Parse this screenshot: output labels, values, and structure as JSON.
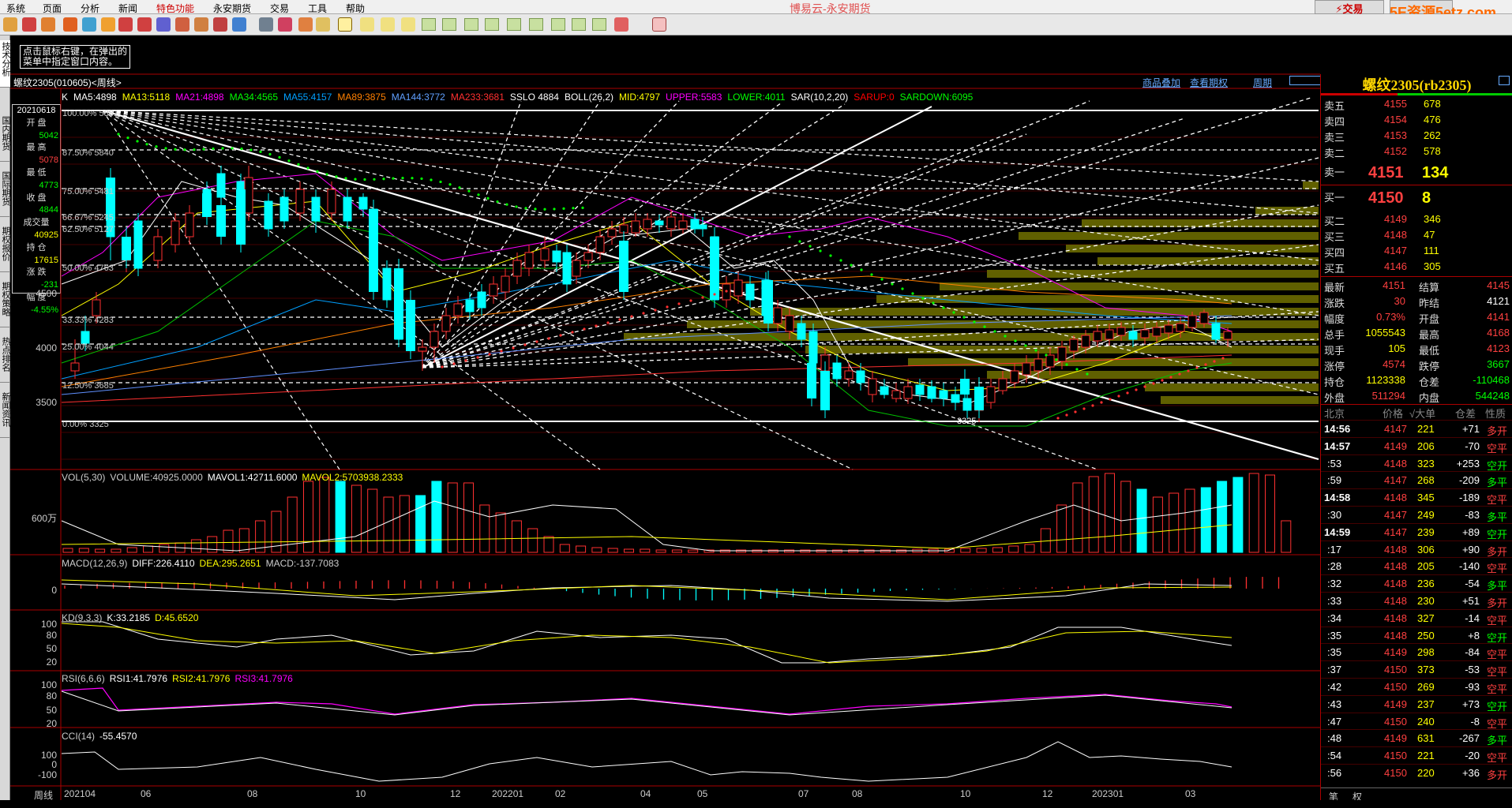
{
  "menu": {
    "items": [
      "系统",
      "页面",
      "分析",
      "新闻",
      "特色功能",
      "永安期货",
      "交易",
      "工具",
      "帮助"
    ],
    "title": "博易云-永安期货",
    "trade": "⚡交易",
    "watermark": "5E资源5etz.com"
  },
  "left_tabs": [
    "技术分析",
    "国内期货",
    "国际期货",
    "期权报价",
    "期权策略",
    "热点排名",
    "新闻资讯"
  ],
  "hint": "点击鼠标右键，在弹出的菜单中指定窗口内容。",
  "chart": {
    "symbol_label": "螺纹2305(010605)<周线>",
    "links": [
      "商品叠加",
      "查看期权",
      "周期"
    ],
    "ma_line": [
      {
        "t": "K",
        "c": "#ffffff"
      },
      {
        "t": "MA5:4898",
        "c": "#ffffff"
      },
      {
        "t": "MA13:5118",
        "c": "#ffff00"
      },
      {
        "t": "MA21:4898",
        "c": "#ff00ff"
      },
      {
        "t": "MA34:4565",
        "c": "#00ff00"
      },
      {
        "t": "MA55:4157",
        "c": "#00a0ff"
      },
      {
        "t": "MA89:3875",
        "c": "#ff8000"
      },
      {
        "t": "MA144:3772",
        "c": "#60a0ff"
      },
      {
        "t": "MA233:3681",
        "c": "#ff3030"
      },
      {
        "t": "SSLO 4884",
        "c": "#ffffff"
      },
      {
        "t": "BOLL(26,2)",
        "c": "#ffffff"
      },
      {
        "t": "MID:4797",
        "c": "#ffff00"
      },
      {
        "t": "UPPER:5583",
        "c": "#ff00ff"
      },
      {
        "t": "LOWER:4011",
        "c": "#00ff00"
      },
      {
        "t": "SAR(10,2,20)",
        "c": "#ffffff"
      },
      {
        "t": "SARUP:0",
        "c": "#ff0000"
      },
      {
        "t": "SARDOWN:6095",
        "c": "#00ff00"
      }
    ],
    "fib": [
      {
        "p": "100.00%",
        "v": "5881"
      },
      {
        "p": "87.50%",
        "v": "5840"
      },
      {
        "p": "75.00%",
        "v": "5481"
      },
      {
        "p": "66.67%",
        "v": "5245"
      },
      {
        "p": "62.50%",
        "v": "5127"
      },
      {
        "p": "50.00%",
        "v": "4763"
      },
      {
        "p": "33.33%",
        "v": "4283"
      },
      {
        "p": "25.00%",
        "v": "4044"
      },
      {
        "p": "12.50%",
        "v": "3685"
      },
      {
        "p": "0.00%",
        "v": "3325"
      }
    ],
    "price_axis": [
      "4500",
      "4000",
      "3500"
    ],
    "low_mark": "3325",
    "vol_label": [
      {
        "t": "VOL(5,30)",
        "c": "#ccc"
      },
      {
        "t": "VOLUME:40925.0000",
        "c": "#ccc"
      },
      {
        "t": "MAVOL1:42711.6000",
        "c": "#ffffff"
      },
      {
        "t": "MAVOL2:5703938.2333",
        "c": "#ffff00"
      }
    ],
    "vol_axis": "600万",
    "macd_label": [
      {
        "t": "MACD(12,26,9)",
        "c": "#ccc"
      },
      {
        "t": "DIFF:226.4110",
        "c": "#ffffff"
      },
      {
        "t": "DEA:295.2651",
        "c": "#ffff00"
      },
      {
        "t": "MACD:-137.7083",
        "c": "#ccc"
      }
    ],
    "macd_axis": "0",
    "kd_label": [
      {
        "t": "KD(9,3,3)",
        "c": "#ccc"
      },
      {
        "t": "K:33.2185",
        "c": "#ffffff"
      },
      {
        "t": "D:45.6520",
        "c": "#ffff00"
      }
    ],
    "kd_axis": [
      "100",
      "80",
      "50",
      "20"
    ],
    "rsi_label": [
      {
        "t": "RSI(6,6,6)",
        "c": "#ccc"
      },
      {
        "t": "RSI1:41.7976",
        "c": "#ffffff"
      },
      {
        "t": "RSI2:41.7976",
        "c": "#ffff00"
      },
      {
        "t": "RSI3:41.7976",
        "c": "#ff00ff"
      }
    ],
    "rsi_axis": [
      "100",
      "80",
      "50",
      "20"
    ],
    "cci_label": [
      {
        "t": "CCI(14)",
        "c": "#ccc"
      },
      {
        "t": "-55.4570",
        "c": "#ffffff"
      }
    ],
    "cci_axis": [
      "100",
      "0",
      "-100"
    ],
    "x_axis": [
      "周线",
      "202104",
      "06",
      "08",
      "10",
      "12",
      "202201",
      "02",
      "04",
      "05",
      "07",
      "08",
      "10",
      "12",
      "202301",
      "03"
    ]
  },
  "info": {
    "date": "20210618",
    "rows": [
      {
        "l": "开  盘",
        "v": "5042",
        "c": "#00ff00"
      },
      {
        "l": "最  高",
        "v": "5078",
        "c": "#ff4040"
      },
      {
        "l": "最  低",
        "v": "4773",
        "c": "#00ff00"
      },
      {
        "l": "收  盘",
        "v": "4844",
        "c": "#00ff00"
      },
      {
        "l": "成交量",
        "v": "40925",
        "c": "#ffff00"
      },
      {
        "l": "持  仓",
        "v": "17615",
        "c": "#ffff00"
      },
      {
        "l": "涨  跌",
        "v": "-231",
        "c": "#00ff00"
      },
      {
        "l": "幅  度",
        "v": "-4.55%",
        "c": "#00ff00"
      }
    ]
  },
  "quote": {
    "title": "螺纹2305(rb2305)",
    "asks": [
      {
        "l": "卖五",
        "p": "4155",
        "v": "678"
      },
      {
        "l": "卖四",
        "p": "4154",
        "v": "476"
      },
      {
        "l": "卖三",
        "p": "4153",
        "v": "262"
      },
      {
        "l": "卖二",
        "p": "4152",
        "v": "578"
      },
      {
        "l": "卖一",
        "p": "4151",
        "v": "134"
      }
    ],
    "bids": [
      {
        "l": "买一",
        "p": "4150",
        "v": "8"
      },
      {
        "l": "买二",
        "p": "4149",
        "v": "346"
      },
      {
        "l": "买三",
        "p": "4148",
        "v": "47"
      },
      {
        "l": "买四",
        "p": "4147",
        "v": "111"
      },
      {
        "l": "买五",
        "p": "4146",
        "v": "305"
      }
    ],
    "stats": [
      {
        "l1": "最新",
        "v1": "4151",
        "c1": "#ff4040",
        "l2": "结算",
        "v2": "4145",
        "c2": "#ff4040"
      },
      {
        "l1": "涨跌",
        "v1": "30",
        "c1": "#ff4040",
        "l2": "昨结",
        "v2": "4121",
        "c2": "#ffffff"
      },
      {
        "l1": "幅度",
        "v1": "0.73%",
        "c1": "#ff4040",
        "l2": "开盘",
        "v2": "4141",
        "c2": "#ff4040"
      },
      {
        "l1": "总手",
        "v1": "1055543",
        "c1": "#ffff00",
        "l2": "最高",
        "v2": "4168",
        "c2": "#ff4040"
      },
      {
        "l1": "现手",
        "v1": "105",
        "c1": "#ffff00",
        "l2": "最低",
        "v2": "4123",
        "c2": "#ff4040"
      },
      {
        "l1": "涨停",
        "v1": "4574",
        "c1": "#ff4040",
        "l2": "跌停",
        "v2": "3667",
        "c2": "#00ff00"
      },
      {
        "l1": "持仓",
        "v1": "1123338",
        "c1": "#ffff00",
        "l2": "仓差",
        "v2": "-110468",
        "c2": "#00ff00"
      },
      {
        "l1": "外盘",
        "v1": "511294",
        "c1": "#ff4040",
        "l2": "内盘",
        "v2": "544248",
        "c2": "#00ff00"
      }
    ],
    "tick_header": [
      "北京",
      "价格",
      "√大单",
      "仓差",
      "性质"
    ],
    "ticks": [
      {
        "t": "14:56",
        "p": "4147",
        "v": "221",
        "d": "+71",
        "n": "多开",
        "nc": "#ff4040",
        "big": true
      },
      {
        "t": "14:57",
        "p": "4149",
        "v": "206",
        "d": "-70",
        "n": "空平",
        "nc": "#ff4040",
        "big": true
      },
      {
        "t": ":53",
        "p": "4148",
        "v": "323",
        "d": "+253",
        "n": "空开",
        "nc": "#00ff00"
      },
      {
        "t": ":59",
        "p": "4147",
        "v": "268",
        "d": "-209",
        "n": "多平",
        "nc": "#00ff00"
      },
      {
        "t": "14:58",
        "p": "4148",
        "v": "345",
        "d": "-189",
        "n": "空平",
        "nc": "#ff4040",
        "big": true
      },
      {
        "t": ":30",
        "p": "4147",
        "v": "249",
        "d": "-83",
        "n": "多平",
        "nc": "#00ff00"
      },
      {
        "t": "14:59",
        "p": "4147",
        "v": "239",
        "d": "+89",
        "n": "空开",
        "nc": "#00ff00",
        "big": true
      },
      {
        "t": ":17",
        "p": "4148",
        "v": "306",
        "d": "+90",
        "n": "多开",
        "nc": "#ff4040"
      },
      {
        "t": ":28",
        "p": "4148",
        "v": "205",
        "d": "-140",
        "n": "空平",
        "nc": "#ff4040"
      },
      {
        "t": ":32",
        "p": "4148",
        "v": "236",
        "d": "-54",
        "n": "多平",
        "nc": "#00ff00"
      },
      {
        "t": ":33",
        "p": "4148",
        "v": "230",
        "d": "+51",
        "n": "多开",
        "nc": "#ff4040"
      },
      {
        "t": ":34",
        "p": "4148",
        "v": "327",
        "d": "-14",
        "n": "空平",
        "nc": "#ff4040"
      },
      {
        "t": ":35",
        "p": "4148",
        "v": "250",
        "d": "+8",
        "n": "空开",
        "nc": "#00ff00"
      },
      {
        "t": ":35",
        "p": "4149",
        "v": "298",
        "d": "-84",
        "n": "空平",
        "nc": "#ff4040"
      },
      {
        "t": ":37",
        "p": "4150",
        "v": "373",
        "d": "-53",
        "n": "空平",
        "nc": "#ff4040"
      },
      {
        "t": ":42",
        "p": "4150",
        "v": "269",
        "d": "-93",
        "n": "空平",
        "nc": "#ff4040"
      },
      {
        "t": ":43",
        "p": "4149",
        "v": "237",
        "d": "+73",
        "n": "空开",
        "nc": "#00ff00"
      },
      {
        "t": ":47",
        "p": "4150",
        "v": "240",
        "d": "-8",
        "n": "空平",
        "nc": "#ff4040"
      },
      {
        "t": ":48",
        "p": "4149",
        "v": "631",
        "d": "-267",
        "n": "多平",
        "nc": "#00ff00"
      },
      {
        "t": ":54",
        "p": "4150",
        "v": "221",
        "d": "-20",
        "n": "空平",
        "nc": "#ff4040"
      },
      {
        "t": ":56",
        "p": "4150",
        "v": "220",
        "d": "+36",
        "n": "多开",
        "nc": "#ff4040"
      }
    ],
    "bottom_tabs": [
      "笔",
      "权"
    ]
  }
}
